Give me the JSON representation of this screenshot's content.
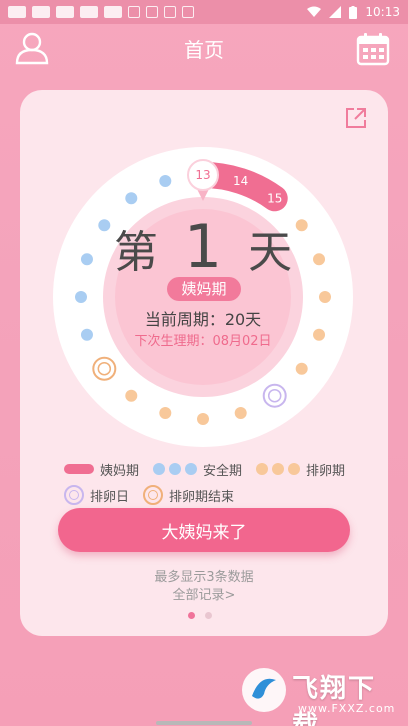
{
  "status_bar": {
    "time": "10:13",
    "notification_icons": [
      "app-icon",
      "app-icon",
      "app-icon",
      "app-icon",
      "app-icon",
      "shield-icon",
      "heart-icon",
      "image-icon",
      "text-a-icon"
    ],
    "system_icons": [
      "wifi-icon",
      "signal-icon",
      "battery-icon"
    ]
  },
  "app_bar": {
    "title": "首页",
    "left_icon": "user-icon",
    "right_icon": "calendar-icon"
  },
  "card": {
    "share_icon": "share-icon",
    "day_prefix": "第",
    "day_number": "1",
    "day_suffix": "天",
    "phase_label": "姨妈期",
    "cycle_text": "当前周期：20天",
    "next_period_text": "下次生理期：08月02日",
    "period_day_labels": [
      "13",
      "14",
      "15"
    ],
    "legend": {
      "period": "姨妈期",
      "safe": "安全期",
      "ovulation_period": "排卵期",
      "ovulation_day": "排卵日",
      "ovulation_end": "排卵期结束"
    },
    "primary_button": "大姨妈来了",
    "limit_hint": "最多显示3条数据",
    "all_records_link": "全部记录>",
    "pager": {
      "count": 2,
      "active": 1
    }
  },
  "colors": {
    "period": "#f06e92",
    "safe": "#a9cdf2",
    "ovulation": "#f8c89a",
    "ovulation_day_ring": "#c8b6ee",
    "ovulation_end_ring": "#f0b07a"
  },
  "watermark": {
    "text": "飞翔下载",
    "sub": "www.FXXZ.com"
  }
}
